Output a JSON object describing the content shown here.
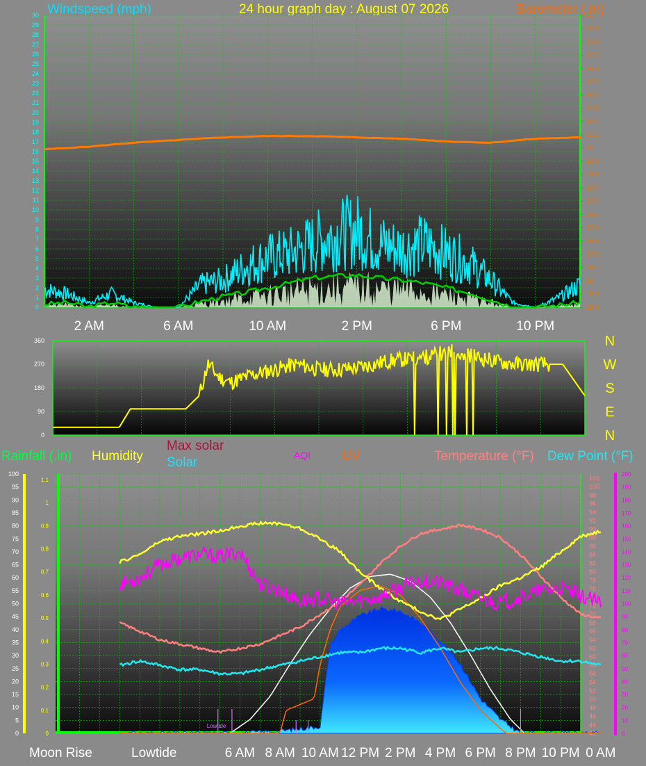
{
  "header": {
    "title": "24 hour graph day : August 07 2026",
    "wind_title": "Windspeed (mph)",
    "baro_title": "Barometer (.in)"
  },
  "colors": {
    "background": "#8a8a8a",
    "grid": "#00e000",
    "wind_title": "#00e0ff",
    "title": "#ffff00",
    "baro_title": "#ff6a00",
    "axis_left_wind": "#00ffff",
    "axis_right_baro": "#e87400"
  },
  "chart_data": [
    {
      "type": "line",
      "x_labels": [
        "2 AM",
        "6 AM",
        "10 AM",
        "2 PM",
        "6 PM",
        "10 PM"
      ],
      "y_left": {
        "min": 0,
        "max": 30,
        "step": 1
      },
      "y_right": {
        "min": 28.8,
        "max": 31,
        "step": 0.1
      },
      "series": [
        {
          "name": "Barometer",
          "axis": "right",
          "color": "#ff7a00",
          "x": [
            0,
            2,
            4,
            6,
            8,
            10,
            12,
            14,
            16,
            18,
            20,
            22,
            24
          ],
          "y": [
            29.99,
            30.01,
            30.04,
            30.06,
            30.08,
            30.09,
            30.09,
            30.08,
            30.07,
            30.05,
            30.04,
            30.07,
            30.08
          ]
        },
        {
          "name": "Wind gust",
          "axis": "left",
          "color": "#00f0ff",
          "x": [
            0,
            1,
            2,
            3,
            4,
            5,
            6,
            7,
            8,
            9,
            10,
            11,
            12,
            13,
            14,
            15,
            16,
            17,
            18,
            19,
            20,
            21,
            22,
            23,
            24
          ],
          "y": [
            2,
            1.5,
            0.5,
            1.5,
            0.5,
            0,
            0,
            2.5,
            3,
            4.5,
            5.5,
            6,
            7,
            8,
            8.5,
            7,
            6.5,
            7,
            6,
            5,
            3,
            0.5,
            0,
            1,
            2.5
          ]
        },
        {
          "name": "Wind avg",
          "axis": "left",
          "color": "#00d000",
          "x": [
            0,
            1,
            2,
            3,
            4,
            5,
            6,
            7,
            8,
            9,
            10,
            11,
            12,
            13,
            14,
            15,
            16,
            17,
            18,
            19,
            20,
            21,
            22,
            23,
            24
          ],
          "y": [
            0.3,
            0.5,
            0,
            0.5,
            0,
            0,
            0,
            0.6,
            1.1,
            1.5,
            2,
            2.5,
            3,
            3.2,
            3.3,
            3,
            2.8,
            2.5,
            2,
            1.5,
            0.8,
            0,
            0,
            0.2,
            0.5
          ]
        }
      ]
    },
    {
      "type": "line",
      "y_left": {
        "min": 0,
        "max": 360,
        "ticks": [
          0,
          90,
          180,
          270,
          360
        ]
      },
      "right_labels": [
        "N",
        "W",
        "S",
        "E",
        "N"
      ],
      "series": [
        {
          "name": "Wind direction",
          "color": "#ffff00",
          "x": [
            0,
            1,
            2,
            3,
            3.5,
            4,
            5,
            6,
            6.6,
            7,
            7.5,
            8,
            9,
            10,
            11,
            12,
            13,
            14,
            15,
            16,
            17,
            18,
            19,
            20,
            21,
            22,
            23,
            24
          ],
          "y": [
            30,
            30,
            30,
            30,
            100,
            100,
            100,
            100,
            150,
            270,
            220,
            200,
            230,
            250,
            270,
            250,
            250,
            260,
            280,
            290,
            300,
            320,
            300,
            280,
            270,
            270,
            270,
            150
          ]
        }
      ]
    },
    {
      "type": "area",
      "legend": [
        "Rainfall (.in)",
        "Humidity",
        "Max solar",
        "Solar",
        "AQI",
        "UV",
        "Temperature (°F)",
        "Dew Point (°F)"
      ],
      "x_labels": [
        "Moon Rise",
        "Lowtide",
        "6 AM",
        "8 AM",
        "10 AM",
        "12 PM",
        "2 PM",
        "4 PM",
        "6 PM",
        "8 PM",
        "10 PM",
        "0 AM"
      ],
      "tide_label": "Lowtide",
      "y_left": {
        "min": 0,
        "max": 100,
        "step": 5
      },
      "y_rain": {
        "min": 0,
        "max": 1.1,
        "step": 0.1
      },
      "y_temp": {
        "min": 42,
        "max": 102,
        "step": 2
      },
      "y_aqi": {
        "min": 0,
        "max": 200,
        "step": 10
      },
      "series": [
        {
          "name": "Humidity",
          "axis": "left",
          "color": "#ffff33",
          "x": [
            0,
            1,
            2,
            3,
            4,
            5,
            6,
            7,
            8,
            9,
            10,
            11,
            12,
            13,
            14,
            15,
            16,
            17,
            18,
            19,
            20,
            21,
            22,
            23,
            24
          ],
          "y": [
            66,
            69,
            74,
            76,
            77,
            78,
            80,
            81,
            81,
            79,
            75,
            70,
            62,
            56,
            51,
            47,
            44,
            48,
            52,
            57,
            60,
            64,
            70,
            76,
            78
          ]
        },
        {
          "name": "Temperature",
          "axis": "temp",
          "color": "#ff8080",
          "x": [
            0,
            1,
            2,
            3,
            4,
            5,
            6,
            7,
            8,
            9,
            10,
            11,
            12,
            13,
            14,
            15,
            16,
            17,
            18,
            19,
            20,
            21,
            22,
            23,
            24
          ],
          "y": [
            68,
            66,
            64,
            63,
            62,
            61,
            62,
            63,
            65,
            67,
            70,
            73,
            77,
            82,
            86,
            89,
            90,
            91,
            90,
            88,
            84,
            79,
            74,
            70,
            69
          ]
        },
        {
          "name": "Dew Point",
          "axis": "temp",
          "color": "#20e8f0",
          "x": [
            0,
            1,
            2,
            3,
            4,
            5,
            6,
            7,
            8,
            9,
            10,
            11,
            12,
            13,
            14,
            15,
            16,
            17,
            18,
            19,
            20,
            21,
            22,
            23,
            24
          ],
          "y": [
            58,
            59,
            58,
            57,
            57,
            56,
            56,
            57,
            58,
            59,
            60,
            61,
            61,
            62,
            62,
            61,
            62,
            61,
            62,
            62,
            61,
            60,
            59,
            59,
            58
          ]
        },
        {
          "name": "AQI",
          "axis": "aqi",
          "color": "#ff00ff",
          "x": [
            0,
            1,
            2,
            3,
            4,
            5,
            6,
            7,
            8,
            9,
            10,
            11,
            12,
            13,
            14,
            15,
            16,
            17,
            18,
            19,
            20,
            21,
            22,
            23,
            24
          ],
          "y": [
            115,
            120,
            130,
            135,
            138,
            136,
            140,
            115,
            110,
            102,
            104,
            100,
            102,
            105,
            112,
            118,
            116,
            110,
            104,
            100,
            105,
            110,
            112,
            106,
            100
          ]
        },
        {
          "name": "UV",
          "axis": "rain",
          "color": "#ff6a00",
          "x": [
            0,
            8,
            8.3,
            9.7,
            10,
            10.5,
            11,
            12,
            13,
            14,
            15,
            16,
            17,
            18,
            19,
            19.3,
            24
          ],
          "y": [
            0,
            0,
            0.1,
            0.15,
            0.3,
            0.45,
            0.55,
            0.62,
            0.64,
            0.6,
            0.5,
            0.37,
            0.22,
            0.1,
            0.02,
            0,
            0
          ]
        },
        {
          "name": "Solar",
          "axis": "rain",
          "color": "#0040ff",
          "x": [
            0,
            3,
            5,
            6,
            8,
            9,
            10,
            10.5,
            11,
            12,
            13,
            14,
            15,
            16,
            17,
            18,
            19,
            20,
            24
          ],
          "y": [
            0,
            0,
            0,
            0,
            0.01,
            0.02,
            0.03,
            0.38,
            0.45,
            0.51,
            0.54,
            0.53,
            0.48,
            0.4,
            0.3,
            0.15,
            0.06,
            0,
            0
          ]
        },
        {
          "name": "Max solar",
          "axis": "rain",
          "color": "#ffffff",
          "x": [
            5.5,
            6.5,
            7.5,
            8.5,
            9.5,
            10.5,
            11.5,
            12.5,
            13.5,
            14.5,
            15.5,
            16.5,
            17.5,
            18.5,
            19.5,
            20.2
          ],
          "y": [
            0,
            0.06,
            0.16,
            0.3,
            0.43,
            0.54,
            0.63,
            0.68,
            0.69,
            0.66,
            0.59,
            0.48,
            0.34,
            0.19,
            0.06,
            0
          ]
        }
      ]
    }
  ]
}
